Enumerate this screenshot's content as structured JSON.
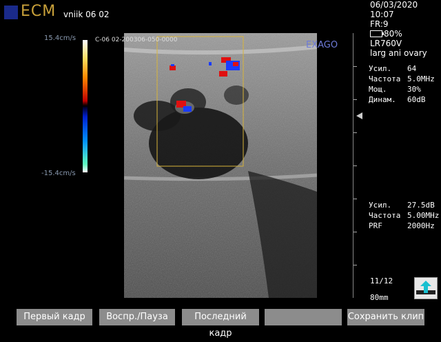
{
  "header": {
    "logo_text": "ECM",
    "patient": "vniik 06 02"
  },
  "status": {
    "date": "06/03/2020",
    "time": "10:07",
    "fr": "FR:9",
    "battery": "80%",
    "probe": "LR760V",
    "preset": "larg ani ovary"
  },
  "scale": {
    "top": "15.4cm/s",
    "bottom": "-15.4cm/s"
  },
  "overlay": {
    "label": "C-06 02-200306-050-0000",
    "brand": "EXAGO"
  },
  "bmode_params": [
    {
      "key": "Усил.",
      "value": "64"
    },
    {
      "key": "Частота",
      "value": "5.0MHz"
    },
    {
      "key": "Мощ.",
      "value": "30%"
    },
    {
      "key": "Динам.",
      "value": "60dB"
    }
  ],
  "doppler_params": [
    {
      "key": "Усил.",
      "value": "27.5dB"
    },
    {
      "key": "Частота",
      "value": "5.00MHz"
    },
    {
      "key": "PRF",
      "value": "2000Hz"
    }
  ],
  "cine": {
    "frames": "11/12",
    "depth": "80mm"
  },
  "buttons": {
    "first": "Первый кадр",
    "playpause": "Воспр./Пауза",
    "last": "Последний кадр",
    "blank": "",
    "save": "Сохранить клип"
  },
  "colors": {
    "logo": "#c9a13a",
    "roi_box": "#d8b43a",
    "button_bg": "#8c8c8c",
    "doppler_red": "#e01010",
    "doppler_blue": "#1a3cff"
  }
}
